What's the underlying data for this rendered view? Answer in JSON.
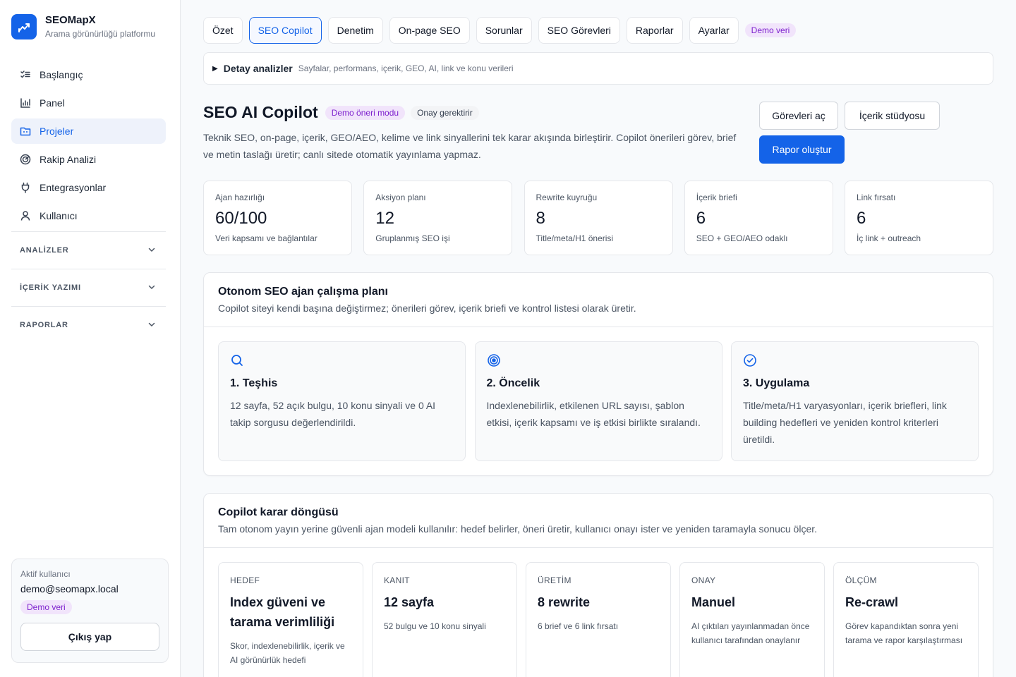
{
  "brand": {
    "name": "SEOMapX",
    "subtitle": "Arama görünürlüğü platformu",
    "logo_icon": "trend-chart-icon",
    "accent": "#1463e8"
  },
  "sidebar": {
    "items": [
      {
        "label": "Başlangıç",
        "icon": "checklist-icon",
        "active": false
      },
      {
        "label": "Panel",
        "icon": "bar-chart-icon",
        "active": false
      },
      {
        "label": "Projeler",
        "icon": "folder-icon",
        "active": true
      },
      {
        "label": "Rakip Analizi",
        "icon": "radar-icon",
        "active": false
      },
      {
        "label": "Entegrasyonlar",
        "icon": "plug-icon",
        "active": false
      },
      {
        "label": "Kullanıcı",
        "icon": "user-icon",
        "active": false
      }
    ],
    "sections": [
      {
        "label": "ANALİZLER"
      },
      {
        "label": "İÇERİK YAZIMI"
      },
      {
        "label": "RAPORLAR"
      }
    ],
    "user": {
      "label": "Aktif kullanıcı",
      "email": "demo@seomapx.local",
      "badge": "Demo veri",
      "logout": "Çıkış yap"
    }
  },
  "tabs": [
    {
      "label": "Özet",
      "active": false
    },
    {
      "label": "SEO Copilot",
      "active": true
    },
    {
      "label": "Denetim",
      "active": false
    },
    {
      "label": "On-page SEO",
      "active": false
    },
    {
      "label": "Sorunlar",
      "active": false
    },
    {
      "label": "SEO Görevleri",
      "active": false
    },
    {
      "label": "Raporlar",
      "active": false
    },
    {
      "label": "Ayarlar",
      "active": false
    }
  ],
  "tabs_badge": "Demo veri",
  "details": {
    "title": "Detay analizler",
    "subtitle": "Sayfalar, performans, içerik, GEO, AI, link ve konu verileri"
  },
  "hero": {
    "title": "SEO AI Copilot",
    "badge_mode": "Demo öneri modu",
    "badge_approval": "Onay gerektirir",
    "description": "Teknik SEO, on-page, içerik, GEO/AEO, kelime ve link sinyallerini tek karar akışında birleştirir. Copilot önerileri görev, brief ve metin taslağı üretir; canlı sitede otomatik yayınlama yapmaz.",
    "actions": {
      "tasks": "Görevleri aç",
      "studio": "İçerik stüdyosu",
      "report": "Rapor oluştur"
    }
  },
  "stats": [
    {
      "label": "Ajan hazırlığı",
      "value": "60/100",
      "sub": "Veri kapsamı ve bağlantılar"
    },
    {
      "label": "Aksiyon planı",
      "value": "12",
      "sub": "Gruplanmış SEO işi"
    },
    {
      "label": "Rewrite kuyruğu",
      "value": "8",
      "sub": "Title/meta/H1 önerisi"
    },
    {
      "label": "İçerik briefi",
      "value": "6",
      "sub": "SEO + GEO/AEO odaklı"
    },
    {
      "label": "Link fırsatı",
      "value": "6",
      "sub": "İç link + outreach"
    }
  ],
  "plan": {
    "title": "Otonom SEO ajan çalışma planı",
    "subtitle": "Copilot siteyi kendi başına değiştirmez; önerileri görev, içerik briefi ve kontrol listesi olarak üretir.",
    "cards": [
      {
        "icon": "search-icon",
        "title": "1. Teşhis",
        "text": "12 sayfa, 52 açık bulgu, 10 konu sinyali ve 0 AI takip sorgusu değerlendirildi."
      },
      {
        "icon": "target-icon",
        "title": "2. Öncelik",
        "text": "Indexlenebilirlik, etkilenen URL sayısı, şablon etkisi, içerik kapsamı ve iş etkisi birlikte sıralandı."
      },
      {
        "icon": "check-circle-icon",
        "title": "3. Uygulama",
        "text": "Title/meta/H1 varyasyonları, içerik briefleri, link building hedefleri ve yeniden kontrol kriterleri üretildi."
      }
    ]
  },
  "loop": {
    "title": "Copilot karar döngüsü",
    "subtitle": "Tam otonom yayın yerine güvenli ajan modeli kullanılır: hedef belirler, öneri üretir, kullanıcı onayı ister ve yeniden taramayla sonucu ölçer.",
    "cards": [
      {
        "label": "HEDEF",
        "title": "Index güveni ve tarama verimliliği",
        "text": "Skor, indexlenebilirlik, içerik ve AI görünürlük hedefi"
      },
      {
        "label": "KANIT",
        "title": "12 sayfa",
        "text": "52 bulgu ve 10 konu sinyali"
      },
      {
        "label": "ÜRETİM",
        "title": "8 rewrite",
        "text": "6 brief ve 6 link fırsatı"
      },
      {
        "label": "ONAY",
        "title": "Manuel",
        "text": "AI çıktıları yayınlanmadan önce kullanıcı tarafından onaylanır"
      },
      {
        "label": "ÖLÇÜM",
        "title": "Re-crawl",
        "text": "Görev kapandıktan sonra yeni tarama ve rapor karşılaştırması"
      }
    ]
  }
}
